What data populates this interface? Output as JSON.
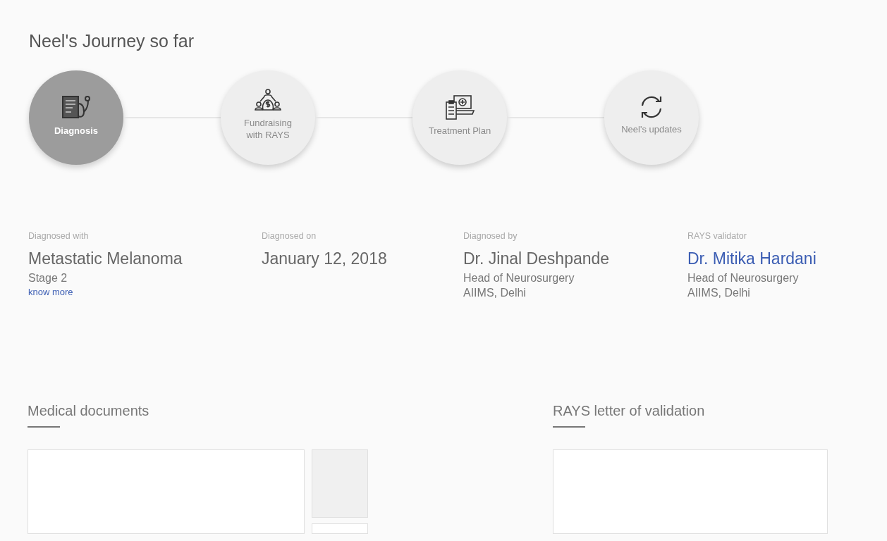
{
  "title": "Neel's Journey so far",
  "steps": [
    {
      "label": "Diagnosis",
      "selected": true
    },
    {
      "label": "Fundraising\nwith RAYS",
      "selected": false
    },
    {
      "label": "Treatment Plan",
      "selected": false
    },
    {
      "label": "Neel's updates",
      "selected": false
    }
  ],
  "details": [
    {
      "label": "Diagnosed with",
      "value": "Metastatic Melanoma",
      "linked": false,
      "lines": [
        "Stage 2"
      ],
      "link": "know more"
    },
    {
      "label": "Diagnosed on",
      "value": "January 12, 2018",
      "linked": false
    },
    {
      "label": "Diagnosed by",
      "value": "Dr. Jinal Deshpande",
      "linked": false,
      "lines": [
        "Head of Neurosurgery",
        "AIIMS, Delhi"
      ]
    },
    {
      "label": "RAYS validator",
      "value": "Dr. Mitika Hardani",
      "linked": true,
      "lines": [
        "Head of Neurosurgery",
        "AIIMS, Delhi"
      ]
    }
  ],
  "sections": [
    {
      "title": "Medical documents",
      "thumbnails": [
        {
          "selected": true
        },
        {
          "selected": false
        }
      ]
    },
    {
      "title": "RAYS letter of validation"
    }
  ]
}
